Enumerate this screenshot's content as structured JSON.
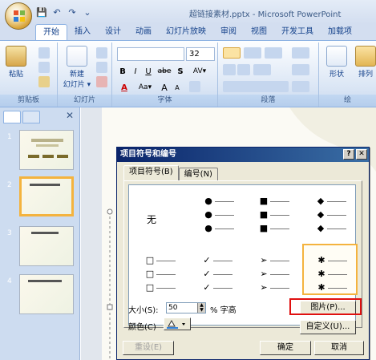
{
  "window": {
    "title": "超链接素材.pptx - Microsoft PowerPoint"
  },
  "quick_access": {
    "save": "💾",
    "undo": "↶",
    "redo": "↷",
    "more": "⌄"
  },
  "tabs": [
    "开始",
    "插入",
    "设计",
    "动画",
    "幻灯片放映",
    "审阅",
    "视图",
    "开发工具",
    "加载项"
  ],
  "ribbon": {
    "clipboard": {
      "label": "剪贴板",
      "paste": "粘贴"
    },
    "slides": {
      "label": "幻灯片",
      "new_slide": "新建",
      "new_slide2": "幻灯片 ▾"
    },
    "font": {
      "label": "字体",
      "size": "32",
      "bold": "B",
      "italic": "I",
      "underline": "U",
      "strike": "abe",
      "shadow": "S",
      "spacing": "AV▾",
      "fontcolor": "A",
      "case": "Aa▾",
      "grow": "A",
      "shrink": "A"
    },
    "paragraph": {
      "label": "段落"
    },
    "drawing": {
      "shape": "形状",
      "arrange": "排列",
      "label": "绘"
    }
  },
  "slides": [
    {
      "num": "1"
    },
    {
      "num": "2",
      "title": "Powerpoint中链接"
    },
    {
      "num": "3",
      "title": "Powerpoint链接"
    },
    {
      "num": "4",
      "title": "Powerpoint 链接"
    }
  ],
  "dialog": {
    "title": "项目符号和编号",
    "help": "?",
    "close": "✕",
    "tabs": [
      "项目符号(B)",
      "编号(N)"
    ],
    "none_label": "无",
    "size_label": "大小(S):",
    "size_value": "50",
    "size_unit": "% 字高",
    "color_label": "颜色(C)",
    "picture_button": "图片(P)...",
    "customize_button": "自定义(U)...",
    "reset_button": "重设(E)",
    "ok_button": "确定",
    "cancel_button": "取消"
  },
  "bullets": {
    "filled_circle": "●",
    "filled_square": "■",
    "diamond": "◆",
    "hollow_square": "□",
    "check": "✓",
    "arrow": "➢",
    "star": "✱"
  }
}
